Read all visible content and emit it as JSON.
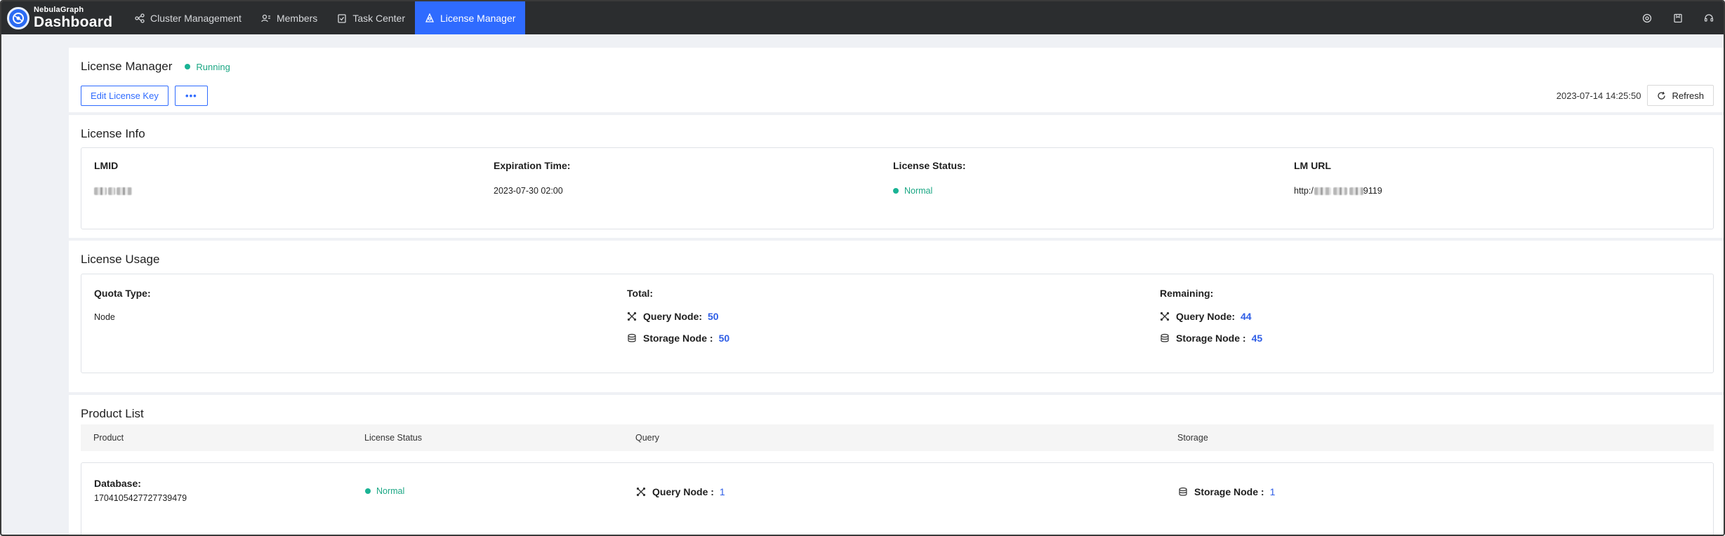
{
  "brand": {
    "small": "NebulaGraph",
    "big": "Dashboard"
  },
  "nav": [
    {
      "label": "Cluster Management",
      "icon": "cluster-icon",
      "active": false
    },
    {
      "label": "Members",
      "icon": "members-icon",
      "active": false
    },
    {
      "label": "Task Center",
      "icon": "task-icon",
      "active": false
    },
    {
      "label": "License Manager",
      "icon": "license-icon",
      "active": true
    }
  ],
  "header": {
    "title": "License Manager",
    "status": "Running",
    "edit_button": "Edit License Key",
    "more_button": "•••",
    "timestamp": "2023-07-14 14:25:50",
    "refresh_button": "Refresh"
  },
  "license_info": {
    "title": "License Info",
    "lmid_label": "LMID",
    "expiration_label": "Expiration Time:",
    "expiration_value": "2023-07-30 02:00",
    "status_label": "License Status:",
    "status_value": "Normal",
    "url_label": "LM URL",
    "url_prefix": "http:/",
    "url_suffix": "9119"
  },
  "license_usage": {
    "title": "License Usage",
    "quota_type_label": "Quota Type:",
    "quota_type_value": "Node",
    "total_label": "Total:",
    "remaining_label": "Remaining:",
    "query_node_label": "Query Node:",
    "storage_node_label": "Storage Node :",
    "total_query": "50",
    "total_storage": "50",
    "remaining_query": "44",
    "remaining_storage": "45"
  },
  "product_list": {
    "title": "Product List",
    "columns": [
      "Product",
      "License Status",
      "Query",
      "Storage"
    ],
    "rows": [
      {
        "product_label": "Database:",
        "product_id": "1704105427727739479",
        "status": "Normal",
        "query_label": "Query Node :",
        "query_value": "1",
        "storage_label": "Storage Node :",
        "storage_value": "1"
      }
    ]
  },
  "colors": {
    "accent": "#2f6bff",
    "success": "#1ab394",
    "topbar": "#2b2d2f"
  }
}
